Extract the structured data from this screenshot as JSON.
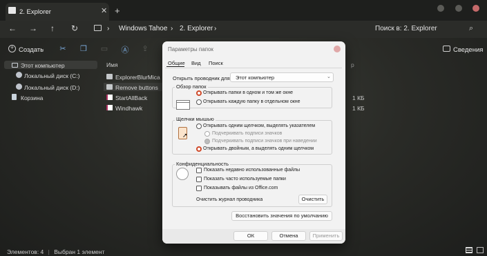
{
  "tabbar": {
    "tab_title": "2. Explorer",
    "close": "✕",
    "new_tab": "+"
  },
  "nav": {
    "back": "←",
    "forward": "→",
    "up": "↑",
    "refresh": "↻",
    "breadcrumb": [
      "Windows Tahoe",
      "2. Explorer"
    ],
    "sep": "›",
    "search_label": "Поиск в: 2. Explorer",
    "search_icon": "⌕"
  },
  "toolbar": {
    "new_label": "Создать",
    "new_chev": "⌄",
    "details_label": "Сведения"
  },
  "sidebar": {
    "items": [
      {
        "label": "Этот компьютер"
      },
      {
        "label": "Локальный диск (C:)"
      },
      {
        "label": "Локальный диск (D:)"
      },
      {
        "label": "Корзина"
      }
    ]
  },
  "filelist": {
    "col_name": "Имя",
    "col_size": "р",
    "rows": [
      {
        "name": "ExplorerBlurMica",
        "size": ""
      },
      {
        "name": "Remove buttons",
        "size": ""
      },
      {
        "name": "StartAllBack",
        "size": "1 КБ"
      },
      {
        "name": "Windhawk",
        "size": "1 КБ"
      }
    ]
  },
  "status": {
    "items": "Элементов: 4",
    "sep": "|",
    "selected": "Выбран 1 элемент"
  },
  "dialog": {
    "title": "Параметры папок",
    "tabs": [
      "Общие",
      "Вид",
      "Поиск"
    ],
    "open_label": "Открыть проводник для:",
    "open_value": "Этот компьютер",
    "browse_group": "Обзор папок",
    "browse_options": [
      "Открывать папки в одном и том же окне",
      "Открывать каждую папку в отдельном окне"
    ],
    "click_group": "Щелчки мышью",
    "click_options": [
      "Открывать одним щелчком, выделять указателем",
      "Подчеркивать подписи значков",
      "Подчеркивать подписи значков при наведении",
      "Открывать двойным, а выделять одним щелчком"
    ],
    "privacy_group": "Конфиденциальность",
    "privacy_options": [
      "Показать недавно использованные файлы",
      "Показать часто используемые папки",
      "Показывать файлы из Office.com"
    ],
    "clear_label": "Очистить журнал проводника",
    "clear_button": "Очистить",
    "restore_button": "Восстановить значения по умолчанию",
    "ok": "ОК",
    "cancel": "Отмена",
    "apply": "Применить"
  },
  "colors": {
    "accent_radio": "#d04a2a",
    "dialog_bg": "#f2f2f2",
    "window_bg": "#2a2b27"
  }
}
